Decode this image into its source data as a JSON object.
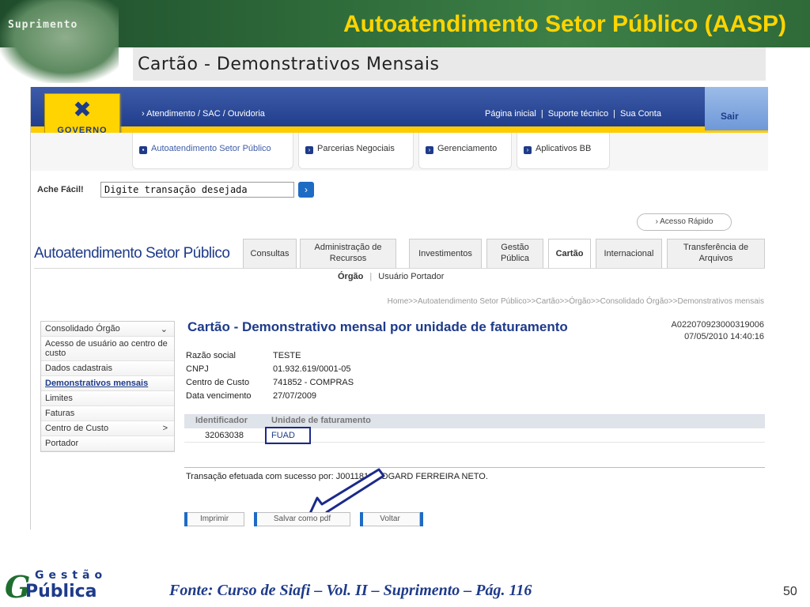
{
  "slide": {
    "badge": "Suprimento",
    "title": "Autoatendimento Setor Público (AASP)",
    "subtitle": "Cartão  - Demonstrativos Mensais",
    "source": "Fonte: Curso de Siafi – Vol. II – Suprimento – Pág. 116",
    "page_number": "50",
    "logo_top": "Gestão",
    "logo_bottom": "Pública",
    "logo_letter": "G",
    "colors": {
      "title_yellow": "#ffd400",
      "bb_blue": "#1e3b8a",
      "header_green": "#2e6b3a"
    }
  },
  "portal": {
    "logo_text": "GOVERNO",
    "atendimento_link": "Atendimento / SAC / Ouvidoria",
    "top_links": [
      "Página inicial",
      "Suporte técnico",
      "Sua Conta"
    ],
    "sair": "Sair",
    "menu_tabs": [
      "Autoatendimento Setor Público",
      "Parcerias Negociais",
      "Gerenciamento",
      "Aplicativos BB"
    ],
    "search": {
      "label": "Ache Fácil!",
      "value": "Digite transação desejada"
    },
    "acesso_rapido": "Acesso Rápido",
    "heading": "Autoatendimento Setor Público",
    "nav_tabs": [
      "Consultas",
      "Administração de Recursos",
      "Investimentos",
      "Gestão Pública",
      "Cartão",
      "Internacional",
      "Transferência de Arquivos"
    ],
    "active_nav_tab": "Cartão",
    "subnav": [
      "Órgão",
      "Usuário Portador"
    ],
    "breadcrumb": "Home>>Autoatendimento Setor Público>>Cartão>>Órgão>>Consolidado Órgão>>Demonstrativos mensais",
    "side_menu": [
      {
        "label": "Consolidado Órgão",
        "arrow": "⌄"
      },
      {
        "label": "Acesso de usuário ao centro de custo",
        "arrow": ""
      },
      {
        "label": "Dados cadastrais",
        "arrow": ""
      },
      {
        "label": "Demonstrativos mensais",
        "arrow": ""
      },
      {
        "label": "Limites",
        "arrow": ""
      },
      {
        "label": "Faturas",
        "arrow": ""
      },
      {
        "label": "Centro de Custo",
        "arrow": ">"
      },
      {
        "label": "Portador",
        "arrow": ""
      }
    ]
  },
  "content": {
    "title": "Cartão - Demonstrativo mensal por unidade de faturamento",
    "doc_id": "A022070923000319006",
    "doc_datetime": "07/05/2010 14:40:16",
    "fields": [
      {
        "key": "Razão social",
        "value": "TESTE"
      },
      {
        "key": "CNPJ",
        "value": "01.932.619/0001-05"
      },
      {
        "key": "Centro de Custo",
        "value": "741852 - COMPRAS"
      },
      {
        "key": "Data vencimento",
        "value": "27/07/2009"
      }
    ],
    "table": {
      "headers": [
        "Identificador",
        "Unidade de faturamento"
      ],
      "rows": [
        {
          "id": "32063038",
          "unit": "FUAD"
        }
      ]
    },
    "success_message": "Transação efetuada com sucesso por: J0011812 EDGARD FERREIRA NETO.",
    "buttons": [
      "Imprimir",
      "Salvar como pdf",
      "Voltar"
    ]
  }
}
